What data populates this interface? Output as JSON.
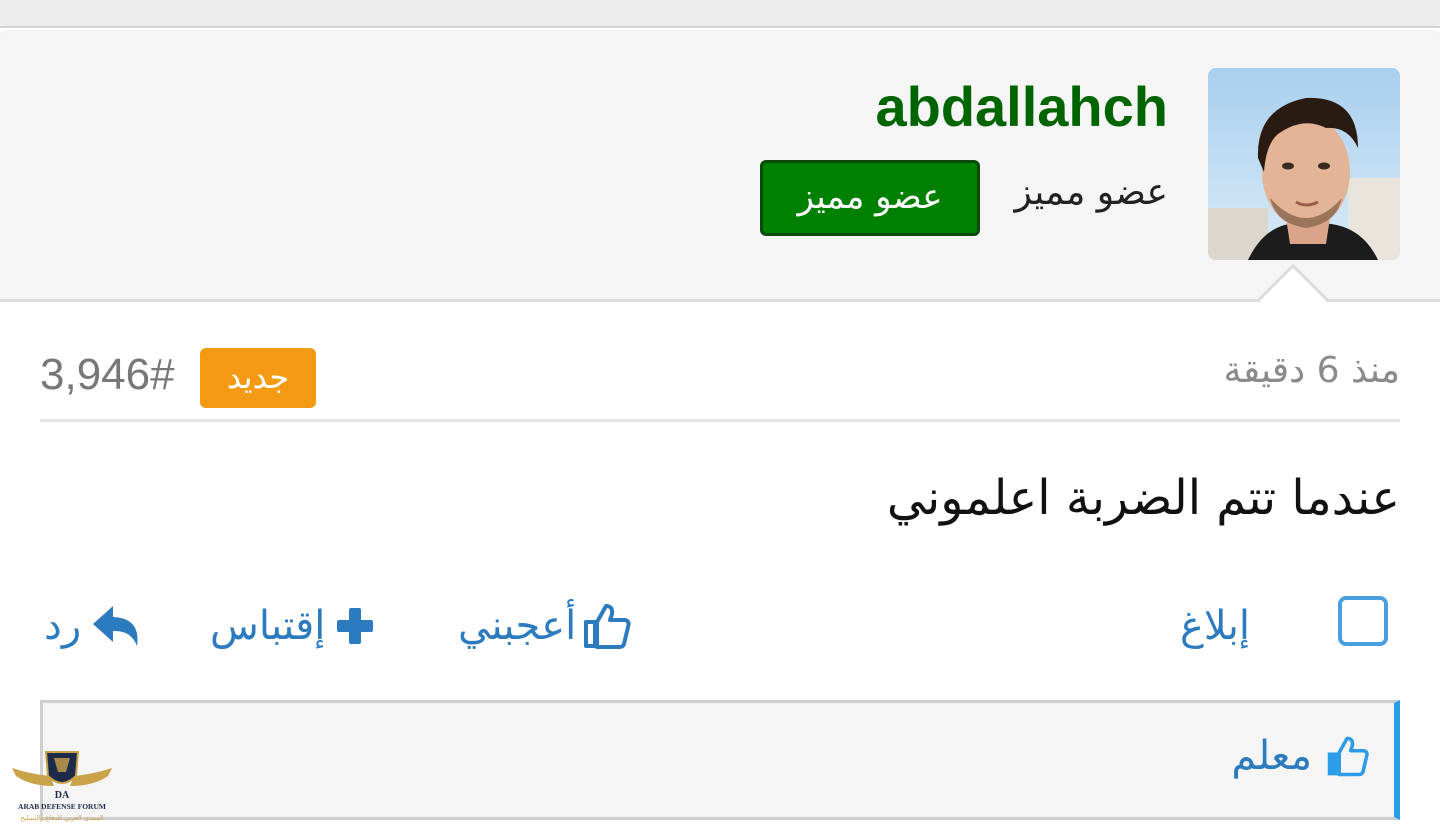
{
  "author": {
    "username": "abdallahch",
    "user_title": "عضو مميز",
    "rank_badge": "عضو مميز",
    "avatar_icon": "user-avatar-photo"
  },
  "post": {
    "time": "منذ 6 دقيقة",
    "new_badge": "جديد",
    "number": "3,946#",
    "body": "عندما تتم الضربة اعلموني"
  },
  "actions": {
    "report": "إبلاغ",
    "like": "أعجبني",
    "quote": "إقتباس",
    "reply": "رد"
  },
  "likes": {
    "users": [
      "معلم"
    ]
  },
  "logo": {
    "abbrev": "DA",
    "name": "ARAB DEFENSE FORUM",
    "arabic": "المنتدى العربي للدفاع والتسليح"
  },
  "colors": {
    "username": "#006400",
    "rank_badge": "#008000",
    "new_badge": "#f39a12",
    "link": "#2c7bbf",
    "likes_accent": "#2c9be8"
  }
}
